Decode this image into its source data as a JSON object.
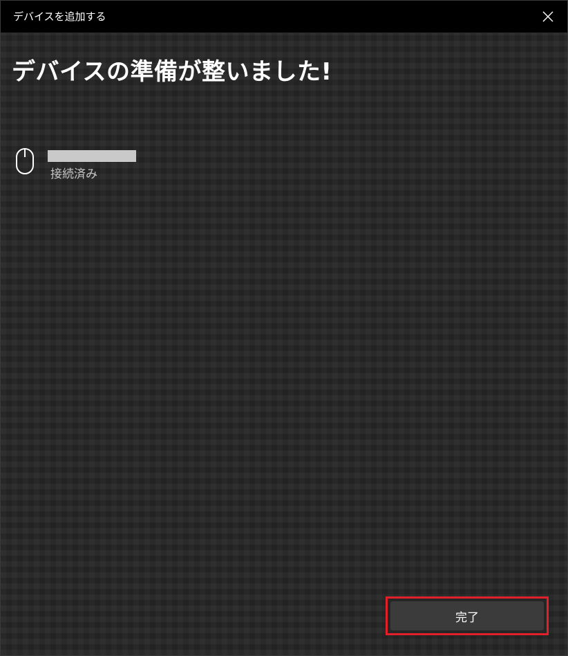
{
  "window": {
    "title": "デバイスを追加する"
  },
  "main": {
    "heading": "デバイスの準備が整いました!",
    "device": {
      "icon": "mouse-icon",
      "status": "接続済み"
    }
  },
  "footer": {
    "done_label": "完了"
  },
  "colors": {
    "titlebar": "#000000",
    "background": "#262626",
    "button": "#3b3b3b",
    "highlight": "#e3202a",
    "status_text": "#c7c7c7"
  }
}
